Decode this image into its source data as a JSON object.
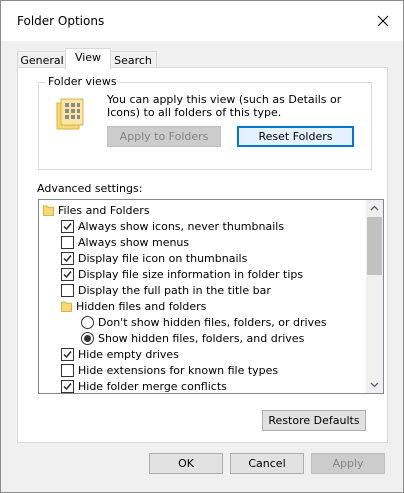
{
  "window": {
    "title": "Folder Options"
  },
  "tabs": [
    {
      "label": "General",
      "active": false
    },
    {
      "label": "View",
      "active": true
    },
    {
      "label": "Search",
      "active": false
    }
  ],
  "folder_views": {
    "legend": "Folder views",
    "description": "You can apply this view (such as Details or Icons) to all folders of this type.",
    "apply_label": "Apply to Folders",
    "reset_label": "Reset Folders"
  },
  "advanced": {
    "label": "Advanced settings:",
    "items": [
      {
        "kind": "folder",
        "text": "Files and Folders"
      },
      {
        "kind": "check",
        "checked": true,
        "text": "Always show icons, never thumbnails"
      },
      {
        "kind": "check",
        "checked": false,
        "text": "Always show menus"
      },
      {
        "kind": "check",
        "checked": true,
        "text": "Display file icon on thumbnails"
      },
      {
        "kind": "check",
        "checked": true,
        "text": "Display file size information in folder tips"
      },
      {
        "kind": "check",
        "checked": false,
        "text": "Display the full path in the title bar"
      },
      {
        "kind": "folder",
        "text": "Hidden files and folders"
      },
      {
        "kind": "radio",
        "checked": false,
        "text": "Don't show hidden files, folders, or drives"
      },
      {
        "kind": "radio",
        "checked": true,
        "text": "Show hidden files, folders, and drives"
      },
      {
        "kind": "check",
        "checked": true,
        "text": "Hide empty drives"
      },
      {
        "kind": "check",
        "checked": false,
        "text": "Hide extensions for known file types"
      },
      {
        "kind": "check",
        "checked": true,
        "text": "Hide folder merge conflicts"
      }
    ]
  },
  "restore_label": "Restore Defaults",
  "footer": {
    "ok": "OK",
    "cancel": "Cancel",
    "apply": "Apply"
  },
  "colors": {
    "accent": "#0078d7",
    "folder": "#f8d775"
  }
}
